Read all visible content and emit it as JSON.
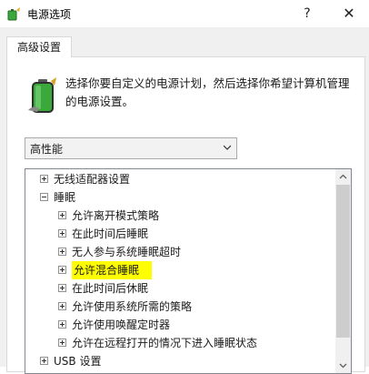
{
  "window": {
    "title": "电源选项",
    "help_glyph": "?",
    "close_glyph": "✕"
  },
  "tabs": [
    {
      "label": "高级设置",
      "active": true
    }
  ],
  "description": "选择你要自定义的电源计划，然后选择你希望计算机管理的电源设置。",
  "plan_select": {
    "value": "高性能"
  },
  "tree": {
    "items": [
      {
        "label": "无线适配器设置",
        "level": 0,
        "expander": "plus"
      },
      {
        "label": "睡眠",
        "level": 0,
        "expander": "minus"
      },
      {
        "label": "允许离开模式策略",
        "level": 1,
        "expander": "plus"
      },
      {
        "label": "在此时间后睡眠",
        "level": 1,
        "expander": "plus"
      },
      {
        "label": "无人参与系统睡眠超时",
        "level": 1,
        "expander": "plus"
      },
      {
        "label": "允许混合睡眠",
        "level": 1,
        "expander": "plus",
        "highlighted": true
      },
      {
        "label": "在此时间后休眠",
        "level": 1,
        "expander": "plus"
      },
      {
        "label": "允许使用系统所需的策略",
        "level": 1,
        "expander": "plus"
      },
      {
        "label": "允许使用唤醒定时器",
        "level": 1,
        "expander": "plus"
      },
      {
        "label": "允许在远程打开的情况下进入睡眠状态",
        "level": 1,
        "expander": "plus"
      },
      {
        "label": "USB 设置",
        "level": 0,
        "expander": "plus"
      }
    ]
  },
  "colors": {
    "highlight": "#fefe00",
    "dialog_bg": "#f0f0f0",
    "battery_green": "#3aa83a"
  },
  "icons": {
    "app": "power-options-icon",
    "battery": "battery-plan-icon"
  }
}
